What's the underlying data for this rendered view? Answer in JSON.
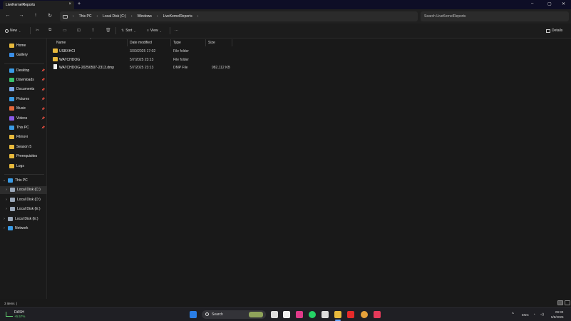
{
  "window": {
    "tab_title": "LiveKernelReports",
    "tab_close": "×",
    "new_tab": "+",
    "controls": {
      "minimize": "–",
      "maximize": "▢",
      "close": "✕"
    }
  },
  "nav": {
    "back": "←",
    "forward": "→",
    "up": "↑",
    "refresh": "↻",
    "breadcrumbs": [
      "This PC",
      "Local Disk (C:)",
      "Windows",
      "LiveKernelReports"
    ],
    "crumb_sep": "›",
    "search_placeholder": "Search LiveKernelReports"
  },
  "toolbar": {
    "new_label": "New",
    "sort_label": "Sort",
    "view_label": "View",
    "more_label": "···",
    "details_label": "Details"
  },
  "sidebar": {
    "top": [
      {
        "label": "Home",
        "icon": "home-icon",
        "color": "#e8b93c"
      },
      {
        "label": "Gallery",
        "icon": "gallery-icon",
        "color": "#3a8ee6"
      }
    ],
    "quick": [
      {
        "label": "Desktop",
        "icon": "desktop-icon",
        "color": "#3a9be6",
        "pinned": true
      },
      {
        "label": "Downloads",
        "icon": "downloads-icon",
        "color": "#3ac06a",
        "pinned": true
      },
      {
        "label": "Documents",
        "icon": "documents-icon",
        "color": "#7aa7e6",
        "pinned": true
      },
      {
        "label": "Pictures",
        "icon": "pictures-icon",
        "color": "#3a9be6",
        "pinned": true
      },
      {
        "label": "Music",
        "icon": "music-icon",
        "color": "#e6683a",
        "pinned": true
      },
      {
        "label": "Videos",
        "icon": "videos-icon",
        "color": "#8a5ae6",
        "pinned": true
      },
      {
        "label": "This PC",
        "icon": "this-pc-icon",
        "color": "#3a9be6",
        "pinned": true
      },
      {
        "label": "Filmovi",
        "icon": "folder-icon",
        "color": "#e8b93c",
        "pinned": false
      },
      {
        "label": "Season 5",
        "icon": "folder-icon",
        "color": "#e8b93c",
        "pinned": false
      },
      {
        "label": "Prerequisites",
        "icon": "folder-icon",
        "color": "#e8b93c",
        "pinned": false
      },
      {
        "label": "Logs",
        "icon": "folder-icon",
        "color": "#e8b93c",
        "pinned": false
      }
    ],
    "pin_glyph": "📌",
    "tree": [
      {
        "label": "This PC",
        "chev": "⌄",
        "icon": "this-pc-icon",
        "color": "#3a9be6"
      },
      {
        "label": "Local Disk (C:)",
        "chev": "›",
        "icon": "drive-icon",
        "color": "#9aa7b8"
      },
      {
        "label": "Local Disk (D:)",
        "chev": "›",
        "icon": "drive-icon",
        "color": "#9aa7b8"
      },
      {
        "label": "Local Disk (E:)",
        "chev": "›",
        "icon": "drive-icon",
        "color": "#9aa7b8"
      },
      {
        "label": "Local Disk (E:)",
        "chev": "›",
        "icon": "drive-icon",
        "color": "#9aa7b8"
      },
      {
        "label": "Network",
        "chev": "›",
        "icon": "network-icon",
        "color": "#3a9be6"
      }
    ]
  },
  "columns": {
    "name": "Name",
    "date": "Date modified",
    "type": "Type",
    "size": "Size"
  },
  "files": [
    {
      "name": "USBXHCI",
      "date": "3/30/2025 17:02",
      "type": "File folder",
      "size": "",
      "kind": "folder"
    },
    {
      "name": "WATCHDOG",
      "date": "5/7/2025 23:13",
      "type": "File folder",
      "size": "",
      "kind": "folder"
    },
    {
      "name": "WATCHDOG-20250507-2313.dmp",
      "date": "5/7/2025 23:13",
      "type": "DMP File",
      "size": "982,112 KB",
      "kind": "file"
    }
  ],
  "status": {
    "items": "3 items",
    "sep": "|"
  },
  "taskbar": {
    "stock_name": "DASH",
    "stock_change": "+5.57%",
    "search_label": "Search",
    "language": "ENG",
    "time": "09:30",
    "date": "5/8/2025",
    "tray_arrow": "^"
  }
}
